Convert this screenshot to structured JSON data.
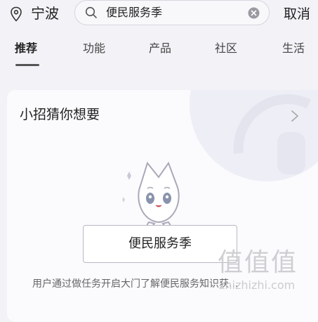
{
  "header": {
    "city": "宁波",
    "search_value": "便民服务季",
    "cancel_label": "取消"
  },
  "tabs": [
    {
      "label": "推荐",
      "active": true
    },
    {
      "label": "功能",
      "active": false
    },
    {
      "label": "产品",
      "active": false
    },
    {
      "label": "社区",
      "active": false
    },
    {
      "label": "生活",
      "active": false
    }
  ],
  "card": {
    "title": "小招猜你想要",
    "button_label": "便民服务季",
    "description": "用户通过做任务开启大门了解便民服务知识获..."
  },
  "watermark": {
    "chars": "值值值",
    "url": "zhizhizhi.com"
  },
  "icons": {
    "location": "location-pin-icon",
    "search": "search-icon",
    "clear": "clear-icon",
    "chevron": "chevron-right-icon",
    "mascot": "cat-mascot-icon"
  },
  "colors": {
    "background": "#f2f2f7",
    "card": "#fbfbfe",
    "text": "#222222",
    "muted": "#666666"
  }
}
